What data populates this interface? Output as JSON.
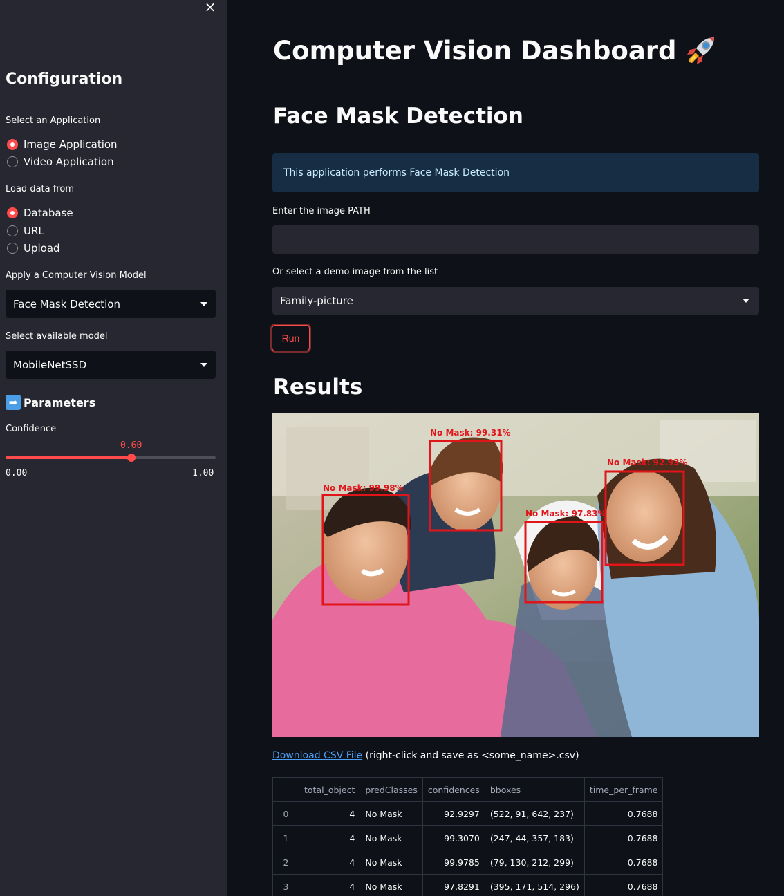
{
  "sidebar": {
    "close_label": "×",
    "title": "Configuration",
    "application": {
      "label": "Select an Application",
      "options": [
        "Image Application",
        "Video Application"
      ],
      "selected_index": 0
    },
    "load": {
      "label": "Load data from",
      "options": [
        "Database",
        "URL",
        "Upload"
      ],
      "selected_index": 0
    },
    "model_select": {
      "label": "Apply a Computer Vision Model",
      "value": "Face Mask Detection"
    },
    "available_model": {
      "label": "Select available model",
      "value": "MobileNetSSD"
    },
    "parameters_title": "Parameters",
    "parameters_icon": "right-arrow-icon",
    "confidence": {
      "label": "Confidence",
      "value": "0.60",
      "min": "0.00",
      "max": "1.00",
      "fraction": 0.6
    }
  },
  "main": {
    "title": "Computer Vision Dashboard",
    "title_icon": "rocket-icon",
    "section": "Face Mask Detection",
    "info": "This application performs Face Mask Detection",
    "path_label": "Enter the image PATH",
    "path_value": "",
    "demo_label": "Or select a demo image from the list",
    "demo_value": "Family-picture",
    "run_label": "Run",
    "results_title": "Results",
    "detections": [
      {
        "label": "No Mask: 99.98%"
      },
      {
        "label": "No Mask: 99.31%"
      },
      {
        "label": "No Mask: 97.83%"
      },
      {
        "label": "No Mask: 92.93%"
      }
    ],
    "download_link": "Download CSV File",
    "download_note": " (right-click and save as <some_name>.csv)"
  },
  "table": {
    "columns": [
      "",
      "total_object",
      "predClasses",
      "confidences",
      "bboxes",
      "time_per_frame"
    ],
    "rows": [
      [
        "0",
        "4",
        "No Mask",
        "92.9297",
        "(522, 91, 642, 237)",
        "0.7688"
      ],
      [
        "1",
        "4",
        "No Mask",
        "99.3070",
        "(247, 44, 357, 183)",
        "0.7688"
      ],
      [
        "2",
        "4",
        "No Mask",
        "99.9785",
        "(79, 130, 212, 299)",
        "0.7688"
      ],
      [
        "3",
        "4",
        "No Mask",
        "97.8291",
        "(395, 171, 514, 296)",
        "0.7688"
      ]
    ]
  },
  "colors": {
    "accent": "#ff4b4b",
    "info_bg": "#172d43",
    "sidebar_bg": "#262730",
    "bg": "#0e1117"
  }
}
